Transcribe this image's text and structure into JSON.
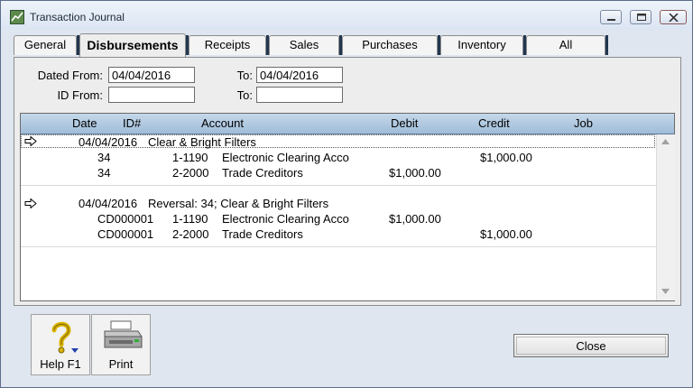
{
  "window": {
    "title": "Transaction Journal",
    "min_glyph": "minimize",
    "max_glyph": "maximize",
    "close_glyph": "close"
  },
  "tabs": [
    {
      "label": "General",
      "active": false
    },
    {
      "label": "Disbursements",
      "active": true
    },
    {
      "label": "Receipts",
      "active": false
    },
    {
      "label": "Sales",
      "active": false
    },
    {
      "label": "Purchases",
      "active": false
    },
    {
      "label": "Inventory",
      "active": false
    },
    {
      "label": "All",
      "active": false
    }
  ],
  "filters": {
    "dated_from_label": "Dated From:",
    "dated_from_value": "04/04/2016",
    "dated_to_label": "To:",
    "dated_to_value": "04/04/2016",
    "id_from_label": "ID From:",
    "id_from_value": "",
    "id_to_label": "To:",
    "id_to_value": ""
  },
  "grid": {
    "headers": {
      "date": "Date",
      "id": "ID#",
      "account": "Account",
      "debit": "Debit",
      "credit": "Credit",
      "job": "Job"
    },
    "transactions": [
      {
        "date": "04/04/2016",
        "memo": "Clear & Bright Filters",
        "lines": [
          {
            "id": "34",
            "account_no": "1-1190",
            "account_name": "Electronic Clearing Acco",
            "debit": "",
            "credit": "$1,000.00"
          },
          {
            "id": "34",
            "account_no": "2-2000",
            "account_name": "Trade Creditors",
            "debit": "$1,000.00",
            "credit": ""
          }
        ]
      },
      {
        "date": "04/04/2016",
        "memo": "Reversal:  34; Clear & Bright Filters",
        "lines": [
          {
            "id": "CD000001",
            "account_no": "1-1190",
            "account_name": "Electronic Clearing Acco",
            "debit": "$1,000.00",
            "credit": ""
          },
          {
            "id": "CD000001",
            "account_no": "2-2000",
            "account_name": "Trade Creditors",
            "debit": "",
            "credit": "$1,000.00"
          }
        ]
      }
    ]
  },
  "buttons": {
    "help_label": "Help F1",
    "print_label": "Print",
    "close_label": "Close"
  },
  "icons": {
    "row_arrow": "right-arrow-icon",
    "help": "question-mark-icon",
    "print": "printer-icon"
  }
}
